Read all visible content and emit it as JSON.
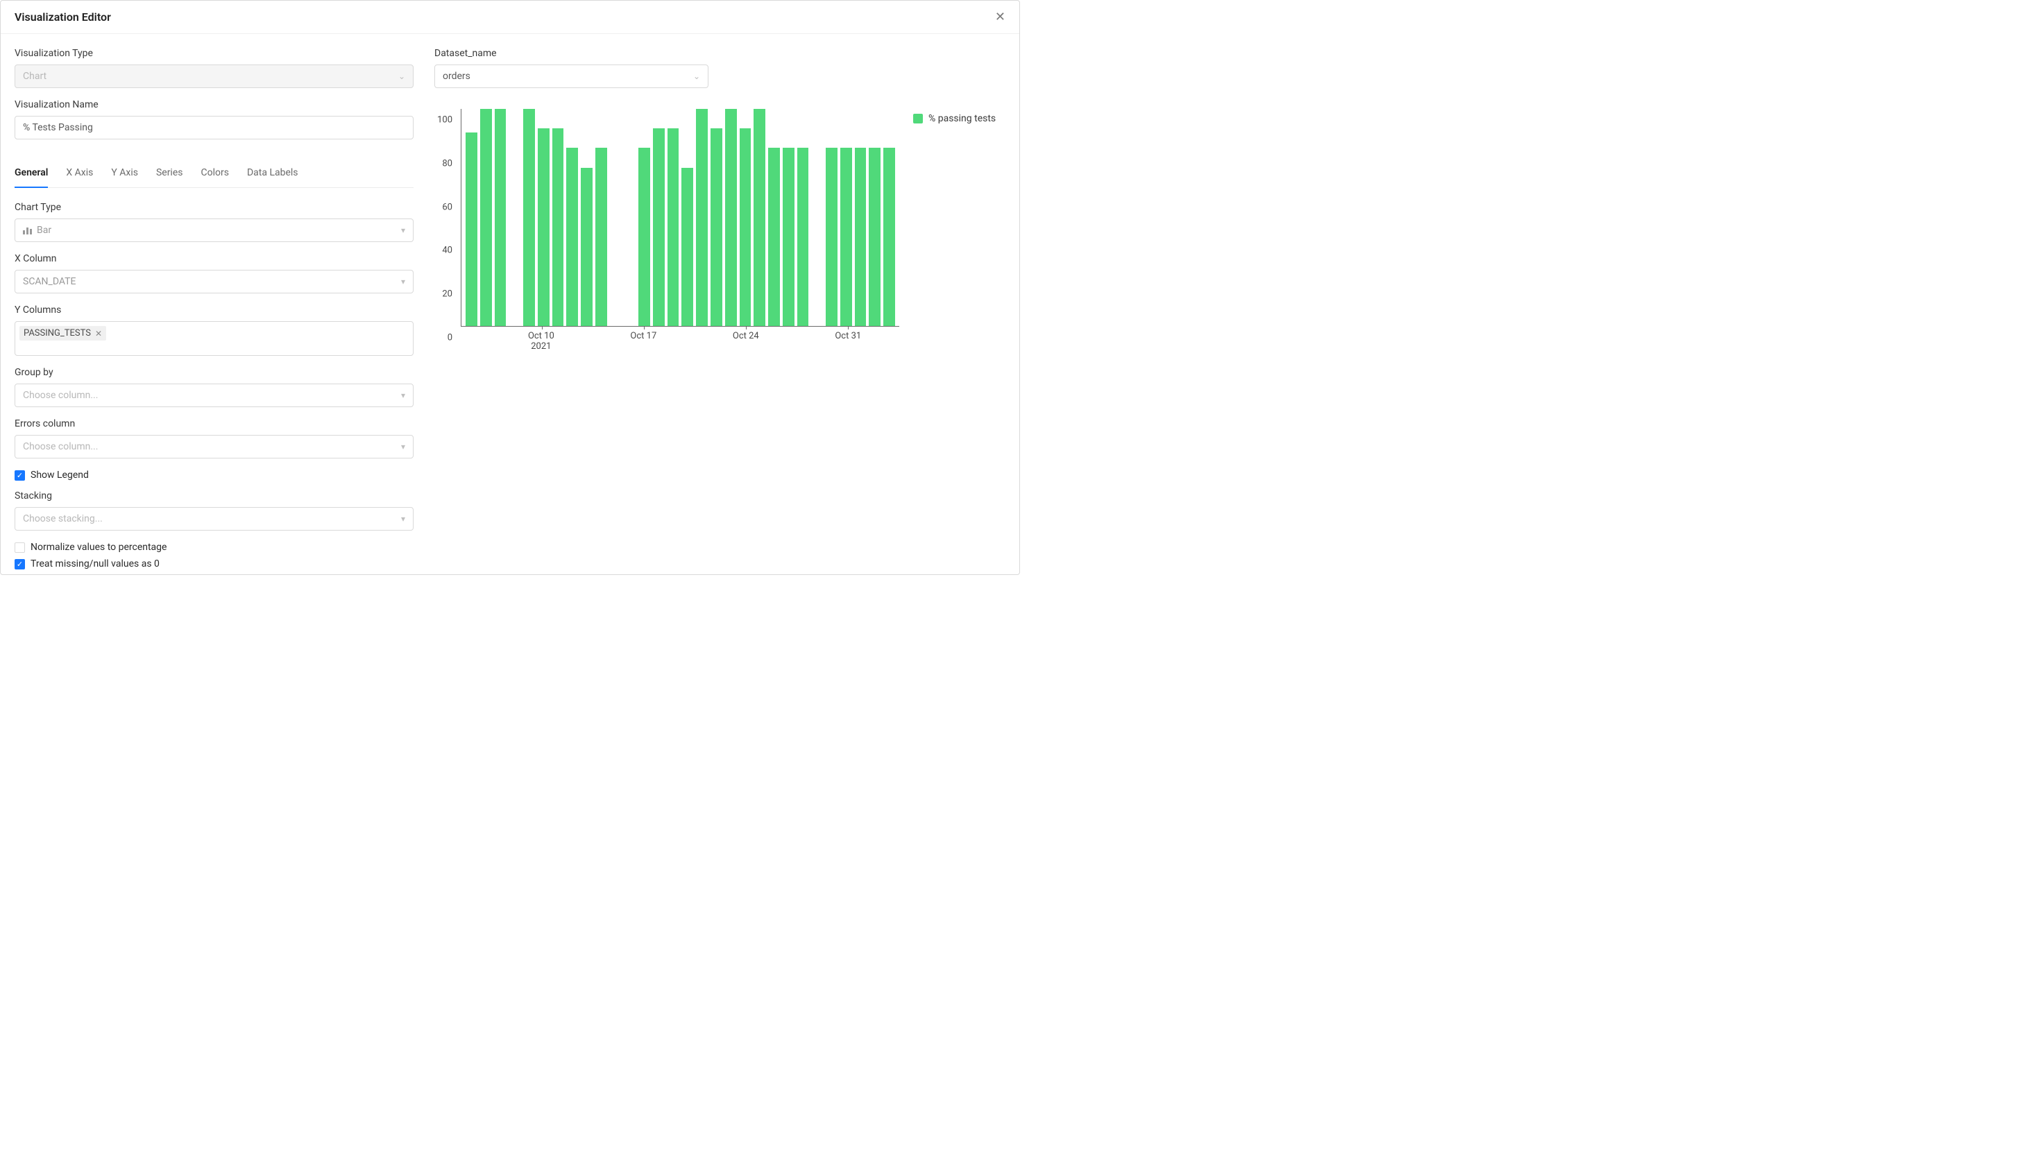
{
  "header": {
    "title": "Visualization Editor"
  },
  "left": {
    "vizTypeLabel": "Visualization Type",
    "vizTypeValue": "Chart",
    "vizNameLabel": "Visualization Name",
    "vizNameValue": "% Tests Passing",
    "tabs": [
      "General",
      "X Axis",
      "Y Axis",
      "Series",
      "Colors",
      "Data Labels"
    ],
    "activeTabIndex": 0,
    "chartTypeLabel": "Chart Type",
    "chartTypeValue": "Bar",
    "xColLabel": "X Column",
    "xColValue": "SCAN_DATE",
    "yColsLabel": "Y Columns",
    "yColTag": "PASSING_TESTS",
    "groupByLabel": "Group by",
    "groupByPlaceholder": "Choose column...",
    "errorsLabel": "Errors column",
    "errorsPlaceholder": "Choose column...",
    "showLegendLabel": "Show Legend",
    "showLegendChecked": true,
    "stackingLabel": "Stacking",
    "stackingPlaceholder": "Choose stacking...",
    "normalizeLabel": "Normalize values to percentage",
    "normalizeChecked": false,
    "treatNullLabel": "Treat missing/null values as 0",
    "treatNullChecked": true
  },
  "right": {
    "datasetLabel": "Dataset_name",
    "datasetValue": "orders",
    "legendLabel": "% passing tests",
    "barColor": "#50d97a"
  },
  "chart_data": {
    "type": "bar",
    "title": "",
    "xlabel": "",
    "ylabel": "",
    "ylim": [
      0,
      100
    ],
    "yTicks": [
      0,
      20,
      40,
      60,
      80,
      100
    ],
    "xTicks": [
      {
        "posIndex": 5,
        "label": "Oct 10",
        "sub": "2021"
      },
      {
        "posIndex": 12,
        "label": "Oct 17",
        "sub": ""
      },
      {
        "posIndex": 19,
        "label": "Oct 24",
        "sub": ""
      },
      {
        "posIndex": 26,
        "label": "Oct 31",
        "sub": ""
      }
    ],
    "categories": [
      "2021-10-05",
      "2021-10-06",
      "2021-10-07",
      "2021-10-08",
      "2021-10-09",
      "2021-10-10",
      "2021-10-11",
      "2021-10-12",
      "2021-10-13",
      "2021-10-14",
      "2021-10-15",
      "2021-10-16",
      "2021-10-17",
      "2021-10-18",
      "2021-10-19",
      "2021-10-20",
      "2021-10-21",
      "2021-10-22",
      "2021-10-23",
      "2021-10-24",
      "2021-10-25",
      "2021-10-26",
      "2021-10-27",
      "2021-10-28",
      "2021-10-29",
      "2021-10-30",
      "2021-10-31",
      "2021-11-01",
      "2021-11-02",
      "2021-11-03"
    ],
    "values": [
      89,
      100,
      100,
      null,
      100,
      91,
      91,
      82,
      73,
      82,
      null,
      null,
      82,
      91,
      91,
      73,
      100,
      91,
      100,
      91,
      100,
      82,
      82,
      82,
      null,
      82,
      82,
      82,
      82,
      82
    ],
    "legend": [
      "% passing tests"
    ]
  }
}
